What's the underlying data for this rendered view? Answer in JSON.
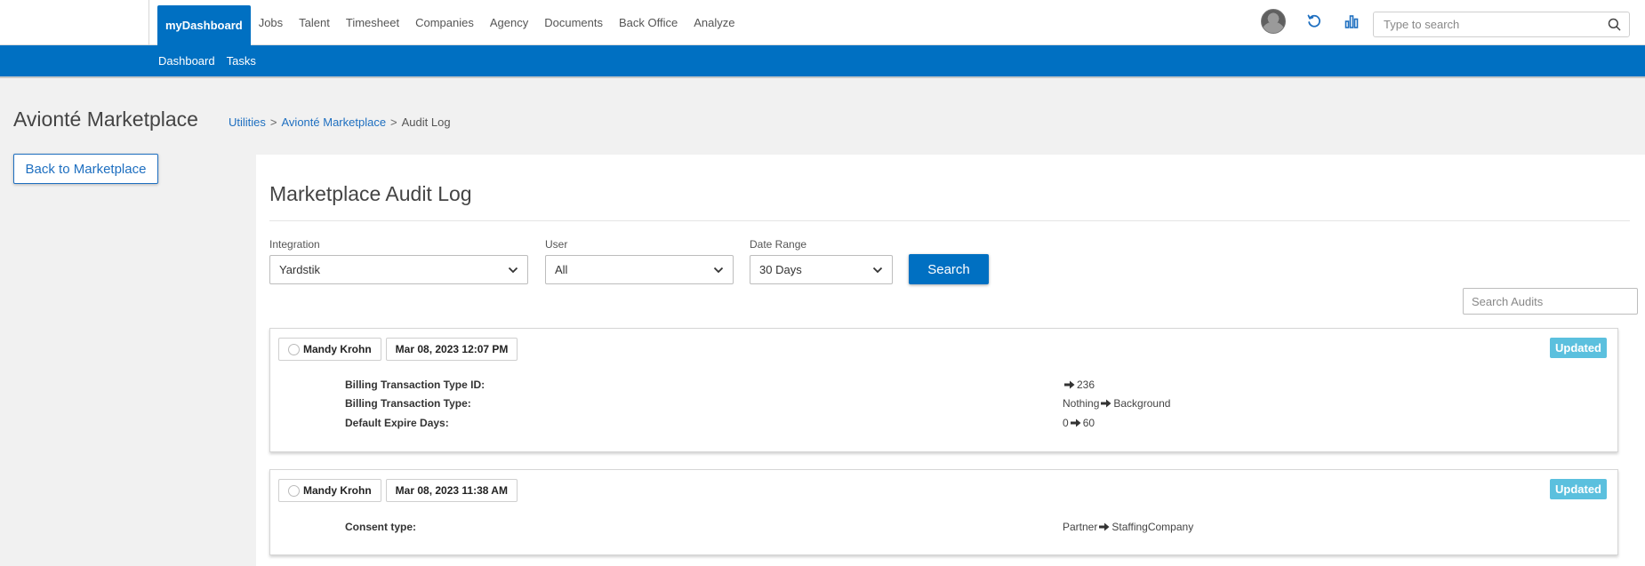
{
  "topnav": {
    "items": [
      {
        "label": "myDashboard",
        "active": true
      },
      {
        "label": "Jobs"
      },
      {
        "label": "Talent"
      },
      {
        "label": "Timesheet"
      },
      {
        "label": "Companies"
      },
      {
        "label": "Agency"
      },
      {
        "label": "Documents"
      },
      {
        "label": "Back Office"
      },
      {
        "label": "Analyze"
      }
    ],
    "icons": [
      "avatar",
      "history-icon",
      "bar-chart-icon"
    ],
    "search": {
      "placeholder": "Type to search",
      "value": ""
    }
  },
  "subnav": {
    "items": [
      "Dashboard",
      "Tasks"
    ]
  },
  "header": {
    "title": "Avionté Marketplace",
    "breadcrumb": [
      "Utilities",
      "Avionté Marketplace",
      "Audit Log"
    ]
  },
  "back_button": "Back to Marketplace",
  "panel": {
    "title": "Marketplace Audit Log",
    "filters": {
      "integration": {
        "label": "Integration",
        "value": "Yardstik"
      },
      "user": {
        "label": "User",
        "value": "All"
      },
      "date_range": {
        "label": "Date Range",
        "value": "30 Days"
      }
    },
    "search_button": "Search",
    "audit_search": {
      "placeholder": "Search Audits",
      "value": ""
    }
  },
  "audits": [
    {
      "user": "Mandy Krohn",
      "timestamp": "Mar 08, 2023 12:07 PM",
      "status": "Updated",
      "changes": [
        {
          "field": "Billing Transaction Type ID:",
          "from": "",
          "to": "236"
        },
        {
          "field": "Billing Transaction Type:",
          "from": "Nothing",
          "to": "Background"
        },
        {
          "field": "Default Expire Days:",
          "from": "0",
          "to": "60"
        }
      ]
    },
    {
      "user": "Mandy Krohn",
      "timestamp": "Mar 08, 2023 11:38 AM",
      "status": "Updated",
      "changes": [
        {
          "field": "Consent type:",
          "from": "Partner",
          "to": "StaffingCompany"
        }
      ]
    }
  ],
  "colors": {
    "primary": "#0070c2",
    "link": "#1e6fc0",
    "badge": "#5bc0de",
    "page_bg": "#f1f1f1"
  }
}
